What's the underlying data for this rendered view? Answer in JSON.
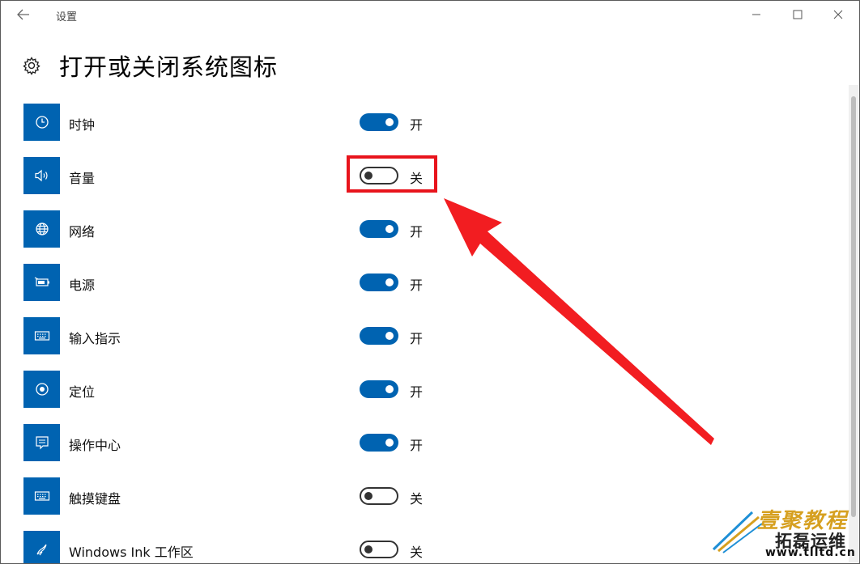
{
  "window": {
    "app_title": "设置"
  },
  "header": {
    "title": "打开或关闭系统图标"
  },
  "items": [
    {
      "label": "时钟",
      "state": "开",
      "on": true,
      "icon": "clock-icon"
    },
    {
      "label": "音量",
      "state": "关",
      "on": false,
      "icon": "volume-icon"
    },
    {
      "label": "网络",
      "state": "开",
      "on": true,
      "icon": "globe-icon"
    },
    {
      "label": "电源",
      "state": "开",
      "on": true,
      "icon": "battery-icon"
    },
    {
      "label": "输入指示",
      "state": "开",
      "on": true,
      "icon": "keyboard-icon"
    },
    {
      "label": "定位",
      "state": "开",
      "on": true,
      "icon": "location-icon"
    },
    {
      "label": "操作中心",
      "state": "开",
      "on": true,
      "icon": "action-center-icon"
    },
    {
      "label": "触摸键盘",
      "state": "关",
      "on": false,
      "icon": "keyboard-icon"
    },
    {
      "label": "Windows Ink 工作区",
      "state": "关",
      "on": false,
      "icon": "pen-icon"
    }
  ],
  "watermark": {
    "line1": "壹聚教程",
    "line2": "拓磊运维",
    "url": "www.tlltd.cn"
  },
  "colors": {
    "accent": "#0063b1",
    "annotation_red": "#e8141c"
  }
}
